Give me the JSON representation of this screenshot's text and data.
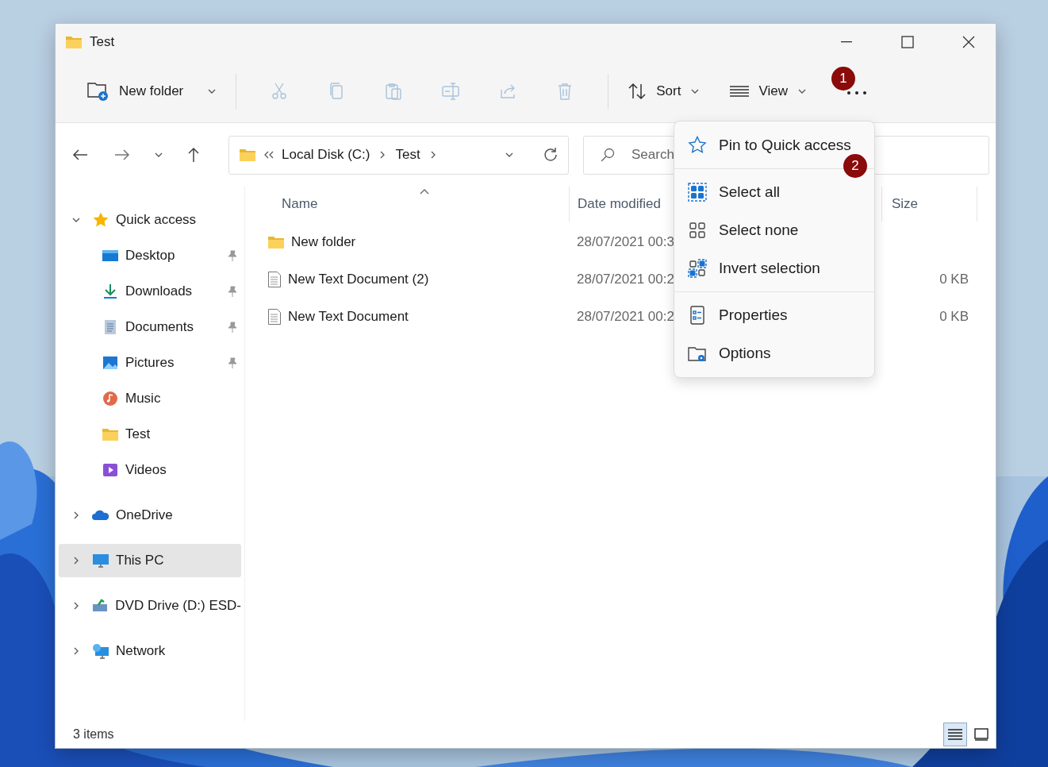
{
  "window": {
    "title": "Test"
  },
  "toolbar": {
    "new_folder": {
      "label": "New folder"
    },
    "actions": [
      {
        "kind": "cut",
        "disabled": true
      },
      {
        "kind": "copy",
        "disabled": true
      },
      {
        "kind": "paste",
        "disabled": true
      },
      {
        "kind": "rename",
        "disabled": true
      },
      {
        "kind": "share",
        "disabled": true
      },
      {
        "kind": "delete",
        "disabled": true
      }
    ],
    "sort": {
      "label": "Sort"
    },
    "view": {
      "label": "View"
    }
  },
  "annotations": [
    {
      "text": "1"
    },
    {
      "text": "2"
    }
  ],
  "navigation": {
    "address": [
      "Local Disk (C:)",
      "Test"
    ],
    "search": {
      "placeholder": "Search"
    }
  },
  "sidebar": {
    "items": [
      {
        "label": "Quick access",
        "kind": "star",
        "expanded": true,
        "selected": false,
        "children": [
          {
            "label": "Desktop",
            "kind": "desktop",
            "pinned": true,
            "selected": false
          },
          {
            "label": "Downloads",
            "kind": "downloads",
            "pinned": true,
            "selected": false
          },
          {
            "label": "Documents",
            "kind": "documents",
            "pinned": true,
            "selected": false
          },
          {
            "label": "Pictures",
            "kind": "pictures",
            "pinned": true,
            "selected": false
          },
          {
            "label": "Music",
            "kind": "music",
            "pinned": false,
            "selected": false
          },
          {
            "label": "Test",
            "kind": "folder",
            "pinned": false,
            "selected": false
          },
          {
            "label": "Videos",
            "kind": "videos",
            "pinned": false,
            "selected": false
          }
        ]
      },
      {
        "label": "OneDrive",
        "kind": "cloud",
        "expanded": false,
        "selected": false
      },
      {
        "label": "This PC",
        "kind": "pc",
        "expanded": false,
        "selected": true
      },
      {
        "label": "DVD Drive (D:) ESD-",
        "kind": "dvd",
        "expanded": false,
        "selected": false
      },
      {
        "label": "Network",
        "kind": "network",
        "expanded": false,
        "selected": false
      }
    ]
  },
  "table": {
    "columns": [
      {
        "label": "Name",
        "sorted": true
      },
      {
        "label": "Date modified",
        "sorted": false
      },
      {
        "label": "Size",
        "sorted": false
      }
    ],
    "rows": [
      {
        "kind": "folder",
        "name": "New folder",
        "date_modified": "28/07/2021 00:3"
      },
      {
        "kind": "text",
        "name": "New Text Document (2)",
        "date_modified": "28/07/2021 00:2",
        "size": "0 KB"
      },
      {
        "kind": "text",
        "name": "New Text Document",
        "date_modified": "28/07/2021 00:2",
        "size": "0 KB"
      }
    ]
  },
  "menu": {
    "sections": [
      {
        "items": [
          {
            "label": "Pin to Quick access",
            "kind": "pin"
          }
        ]
      },
      {
        "items": [
          {
            "label": "Select all",
            "kind": "select_all"
          },
          {
            "label": "Select none",
            "kind": "select_none"
          },
          {
            "label": "Invert selection",
            "kind": "invert"
          }
        ]
      },
      {
        "items": [
          {
            "label": "Properties",
            "kind": "properties"
          },
          {
            "label": "Options",
            "kind": "options"
          }
        ]
      }
    ]
  },
  "status_bar": {
    "count": "3 items",
    "views": [
      {
        "kind": "details",
        "selected": true
      },
      {
        "kind": "tiles",
        "selected": false
      }
    ]
  }
}
